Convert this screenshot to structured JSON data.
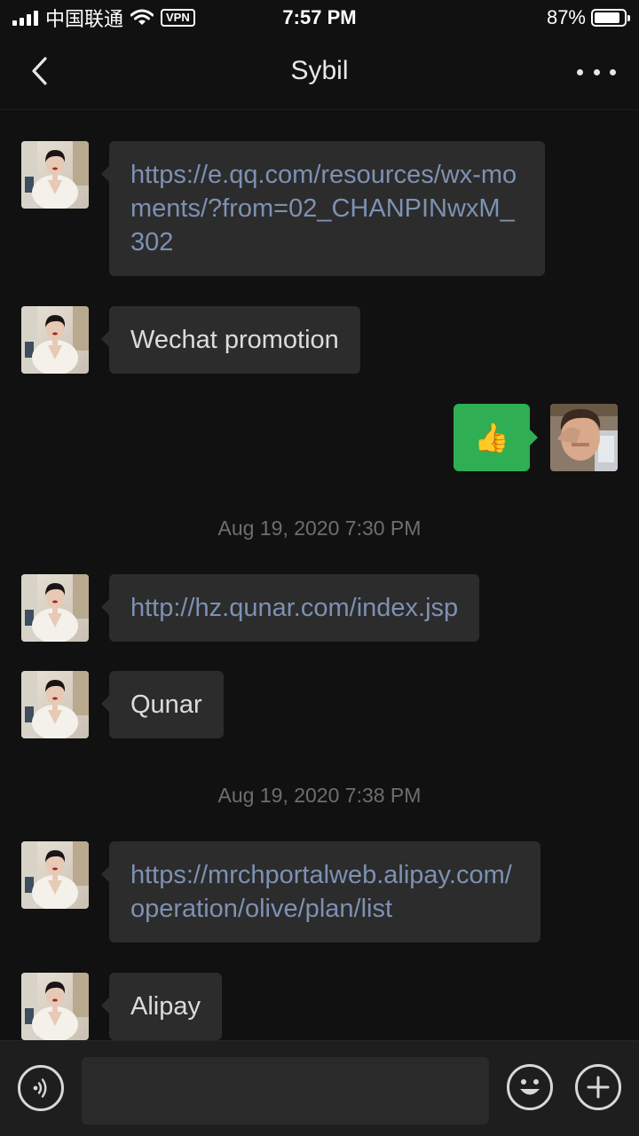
{
  "status_bar": {
    "carrier": "中国联通",
    "vpn": "VPN",
    "time": "7:57 PM",
    "battery_percent": "87%",
    "battery_level": 0.87,
    "signal_bars": 4,
    "icons": [
      "signal-icon",
      "wifi-icon",
      "vpn-badge",
      "battery-icon"
    ]
  },
  "nav": {
    "title": "Sybil",
    "back_icon": "chevron-left-icon",
    "more_icon": "more-dots-icon"
  },
  "messages": [
    {
      "sender": "contact",
      "type": "link",
      "text": "https://e.qq.com/resources/wx-moments/?from=02_CHANPINwxM_302"
    },
    {
      "sender": "contact",
      "type": "text",
      "text": "Wechat promotion"
    },
    {
      "sender": "me",
      "type": "emoji",
      "text": "👍"
    },
    {
      "type": "timestamp",
      "text": "Aug 19, 2020 7:30 PM"
    },
    {
      "sender": "contact",
      "type": "link",
      "text": "http://hz.qunar.com/index.jsp"
    },
    {
      "sender": "contact",
      "type": "text",
      "text": "Qunar"
    },
    {
      "type": "timestamp",
      "text": "Aug 19, 2020 7:38 PM"
    },
    {
      "sender": "contact",
      "type": "link",
      "text": "https://mrchportalweb.alipay.com/operation/olive/plan/list"
    },
    {
      "sender": "contact",
      "type": "text",
      "text": "Alipay"
    }
  ],
  "input_bar": {
    "voice_icon": "voice-icon",
    "input_value": "",
    "emoji_icon": "emoji-icon",
    "plus_icon": "plus-icon"
  },
  "colors": {
    "background": "#111111",
    "bubble_received": "#2c2c2c",
    "bubble_sent": "#2fae53",
    "link": "#7d91b3",
    "timestamp": "#6e6e6e"
  }
}
